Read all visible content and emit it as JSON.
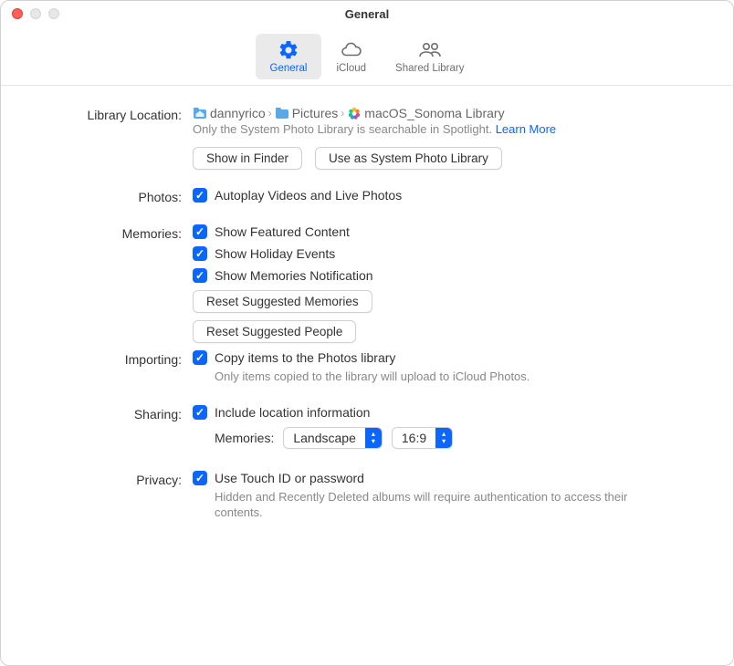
{
  "window": {
    "title": "General"
  },
  "toolbar": {
    "items": [
      {
        "label": "General"
      },
      {
        "label": "iCloud"
      },
      {
        "label": "Shared Library"
      }
    ]
  },
  "library": {
    "section_label": "Library Location:",
    "path": [
      "dannyrico",
      "Pictures",
      "macOS_Sonoma Library"
    ],
    "hint": "Only the System Photo Library is searchable in Spotlight.",
    "learn_more": "Learn More",
    "show_in_finder": "Show in Finder",
    "use_as_system": "Use as System Photo Library"
  },
  "photos": {
    "section_label": "Photos:",
    "autoplay": "Autoplay Videos and Live Photos"
  },
  "memories": {
    "section_label": "Memories:",
    "featured": "Show Featured Content",
    "holiday": "Show Holiday Events",
    "notification": "Show Memories Notification",
    "reset_memories": "Reset Suggested Memories",
    "reset_people": "Reset Suggested People"
  },
  "importing": {
    "section_label": "Importing:",
    "copy": "Copy items to the Photos library",
    "hint": "Only items copied to the library will upload to iCloud Photos."
  },
  "sharing": {
    "section_label": "Sharing:",
    "include_location": "Include location information",
    "memories_label": "Memories:",
    "orientation": "Landscape",
    "aspect": "16:9"
  },
  "privacy": {
    "section_label": "Privacy:",
    "touchid": "Use Touch ID or password",
    "hint": "Hidden and Recently Deleted albums will require authentication to access their contents."
  }
}
